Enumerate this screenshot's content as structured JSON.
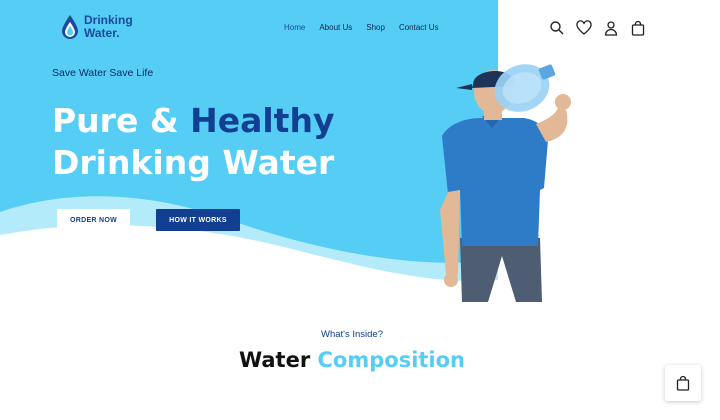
{
  "brand": {
    "line1": "Drinking",
    "line2": "Water."
  },
  "nav": {
    "items": [
      {
        "label": "Home",
        "active": true
      },
      {
        "label": "About Us",
        "active": false
      },
      {
        "label": "Shop",
        "active": false
      },
      {
        "label": "Contact Us",
        "active": false
      }
    ]
  },
  "header_icons": [
    "search-icon",
    "heart-icon",
    "user-icon",
    "shopping-bag-icon"
  ],
  "hero": {
    "tagline": "Save Water Save Life",
    "headline_line1_prefix": "Pure & ",
    "headline_line1_accent": "Healthy",
    "headline_line2": "Drinking Water",
    "order_button": "ORDER NOW",
    "how_button": "HOW IT WORKS"
  },
  "section": {
    "subtitle": "What's Inside?",
    "title_plain": "Water ",
    "title_accent": "Composition"
  },
  "floating_cart_icon": "shopping-bag-icon",
  "colors": {
    "hero_bg": "#56cdf5",
    "wave_light": "#b3ebfb",
    "accent_dark": "#123f91",
    "accent_light": "#56cdf5"
  }
}
